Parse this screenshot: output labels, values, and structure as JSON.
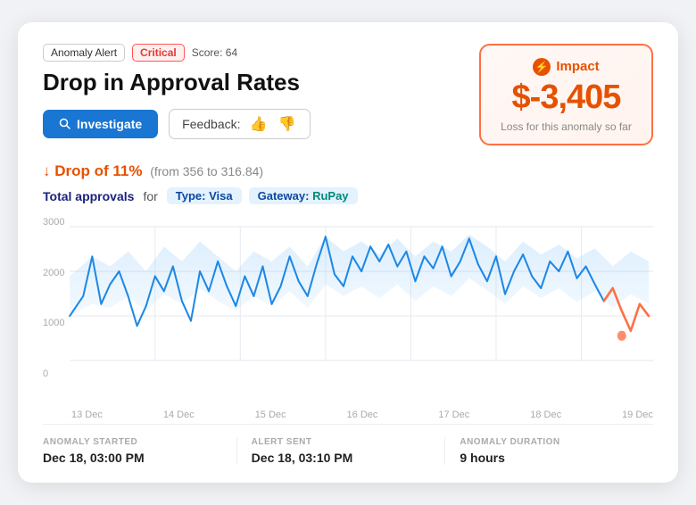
{
  "card": {
    "badges": {
      "anomaly": "Anomaly Alert",
      "critical": "Critical",
      "score_label": "Score:",
      "score_value": "64"
    },
    "title": "Drop in Approval Rates",
    "investigate_btn": "Investigate",
    "feedback_label": "Feedback:",
    "impact": {
      "header": "Impact",
      "value": "$-3,405",
      "description": "Loss for this anomaly so far"
    },
    "drop": {
      "arrow": "↓",
      "text": "Drop of 11%",
      "detail": "(from 356 to 316.84)"
    },
    "filter": {
      "label": "Total approvals",
      "for_label": "for",
      "type_label": "Type:",
      "type_value": "Visa",
      "gateway_label": "Gateway:",
      "gateway_value": "RuPay"
    },
    "chart": {
      "y_labels": [
        "3000",
        "2000",
        "1000",
        "0"
      ],
      "x_labels": [
        "13 Dec",
        "14 Dec",
        "15 Dec",
        "16 Dec",
        "17 Dec",
        "18 Dec",
        "19 Dec"
      ]
    },
    "footer": {
      "started_label": "ANOMALY STARTED",
      "started_value": "Dec 18, 03:00 PM",
      "sent_label": "ALERT SENT",
      "sent_value": "Dec 18, 03:10 PM",
      "duration_label": "ANOMALY DURATION",
      "duration_value": "9 hours"
    }
  }
}
